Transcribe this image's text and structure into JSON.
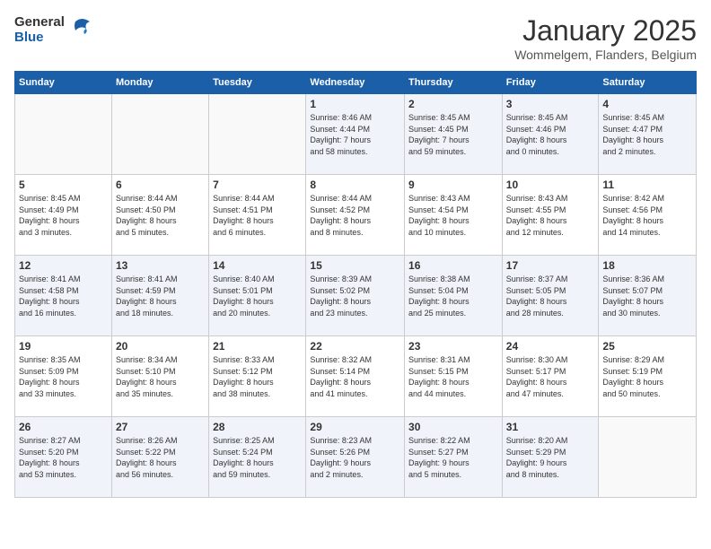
{
  "header": {
    "logo": {
      "general": "General",
      "blue": "Blue"
    },
    "title": "January 2025",
    "location": "Wommelgem, Flanders, Belgium"
  },
  "calendar": {
    "days_of_week": [
      "Sunday",
      "Monday",
      "Tuesday",
      "Wednesday",
      "Thursday",
      "Friday",
      "Saturday"
    ],
    "weeks": [
      [
        {
          "day": "",
          "info": ""
        },
        {
          "day": "",
          "info": ""
        },
        {
          "day": "",
          "info": ""
        },
        {
          "day": "1",
          "info": "Sunrise: 8:46 AM\nSunset: 4:44 PM\nDaylight: 7 hours\nand 58 minutes."
        },
        {
          "day": "2",
          "info": "Sunrise: 8:45 AM\nSunset: 4:45 PM\nDaylight: 7 hours\nand 59 minutes."
        },
        {
          "day": "3",
          "info": "Sunrise: 8:45 AM\nSunset: 4:46 PM\nDaylight: 8 hours\nand 0 minutes."
        },
        {
          "day": "4",
          "info": "Sunrise: 8:45 AM\nSunset: 4:47 PM\nDaylight: 8 hours\nand 2 minutes."
        }
      ],
      [
        {
          "day": "5",
          "info": "Sunrise: 8:45 AM\nSunset: 4:49 PM\nDaylight: 8 hours\nand 3 minutes."
        },
        {
          "day": "6",
          "info": "Sunrise: 8:44 AM\nSunset: 4:50 PM\nDaylight: 8 hours\nand 5 minutes."
        },
        {
          "day": "7",
          "info": "Sunrise: 8:44 AM\nSunset: 4:51 PM\nDaylight: 8 hours\nand 6 minutes."
        },
        {
          "day": "8",
          "info": "Sunrise: 8:44 AM\nSunset: 4:52 PM\nDaylight: 8 hours\nand 8 minutes."
        },
        {
          "day": "9",
          "info": "Sunrise: 8:43 AM\nSunset: 4:54 PM\nDaylight: 8 hours\nand 10 minutes."
        },
        {
          "day": "10",
          "info": "Sunrise: 8:43 AM\nSunset: 4:55 PM\nDaylight: 8 hours\nand 12 minutes."
        },
        {
          "day": "11",
          "info": "Sunrise: 8:42 AM\nSunset: 4:56 PM\nDaylight: 8 hours\nand 14 minutes."
        }
      ],
      [
        {
          "day": "12",
          "info": "Sunrise: 8:41 AM\nSunset: 4:58 PM\nDaylight: 8 hours\nand 16 minutes."
        },
        {
          "day": "13",
          "info": "Sunrise: 8:41 AM\nSunset: 4:59 PM\nDaylight: 8 hours\nand 18 minutes."
        },
        {
          "day": "14",
          "info": "Sunrise: 8:40 AM\nSunset: 5:01 PM\nDaylight: 8 hours\nand 20 minutes."
        },
        {
          "day": "15",
          "info": "Sunrise: 8:39 AM\nSunset: 5:02 PM\nDaylight: 8 hours\nand 23 minutes."
        },
        {
          "day": "16",
          "info": "Sunrise: 8:38 AM\nSunset: 5:04 PM\nDaylight: 8 hours\nand 25 minutes."
        },
        {
          "day": "17",
          "info": "Sunrise: 8:37 AM\nSunset: 5:05 PM\nDaylight: 8 hours\nand 28 minutes."
        },
        {
          "day": "18",
          "info": "Sunrise: 8:36 AM\nSunset: 5:07 PM\nDaylight: 8 hours\nand 30 minutes."
        }
      ],
      [
        {
          "day": "19",
          "info": "Sunrise: 8:35 AM\nSunset: 5:09 PM\nDaylight: 8 hours\nand 33 minutes."
        },
        {
          "day": "20",
          "info": "Sunrise: 8:34 AM\nSunset: 5:10 PM\nDaylight: 8 hours\nand 35 minutes."
        },
        {
          "day": "21",
          "info": "Sunrise: 8:33 AM\nSunset: 5:12 PM\nDaylight: 8 hours\nand 38 minutes."
        },
        {
          "day": "22",
          "info": "Sunrise: 8:32 AM\nSunset: 5:14 PM\nDaylight: 8 hours\nand 41 minutes."
        },
        {
          "day": "23",
          "info": "Sunrise: 8:31 AM\nSunset: 5:15 PM\nDaylight: 8 hours\nand 44 minutes."
        },
        {
          "day": "24",
          "info": "Sunrise: 8:30 AM\nSunset: 5:17 PM\nDaylight: 8 hours\nand 47 minutes."
        },
        {
          "day": "25",
          "info": "Sunrise: 8:29 AM\nSunset: 5:19 PM\nDaylight: 8 hours\nand 50 minutes."
        }
      ],
      [
        {
          "day": "26",
          "info": "Sunrise: 8:27 AM\nSunset: 5:20 PM\nDaylight: 8 hours\nand 53 minutes."
        },
        {
          "day": "27",
          "info": "Sunrise: 8:26 AM\nSunset: 5:22 PM\nDaylight: 8 hours\nand 56 minutes."
        },
        {
          "day": "28",
          "info": "Sunrise: 8:25 AM\nSunset: 5:24 PM\nDaylight: 8 hours\nand 59 minutes."
        },
        {
          "day": "29",
          "info": "Sunrise: 8:23 AM\nSunset: 5:26 PM\nDaylight: 9 hours\nand 2 minutes."
        },
        {
          "day": "30",
          "info": "Sunrise: 8:22 AM\nSunset: 5:27 PM\nDaylight: 9 hours\nand 5 minutes."
        },
        {
          "day": "31",
          "info": "Sunrise: 8:20 AM\nSunset: 5:29 PM\nDaylight: 9 hours\nand 8 minutes."
        },
        {
          "day": "",
          "info": ""
        }
      ]
    ]
  }
}
